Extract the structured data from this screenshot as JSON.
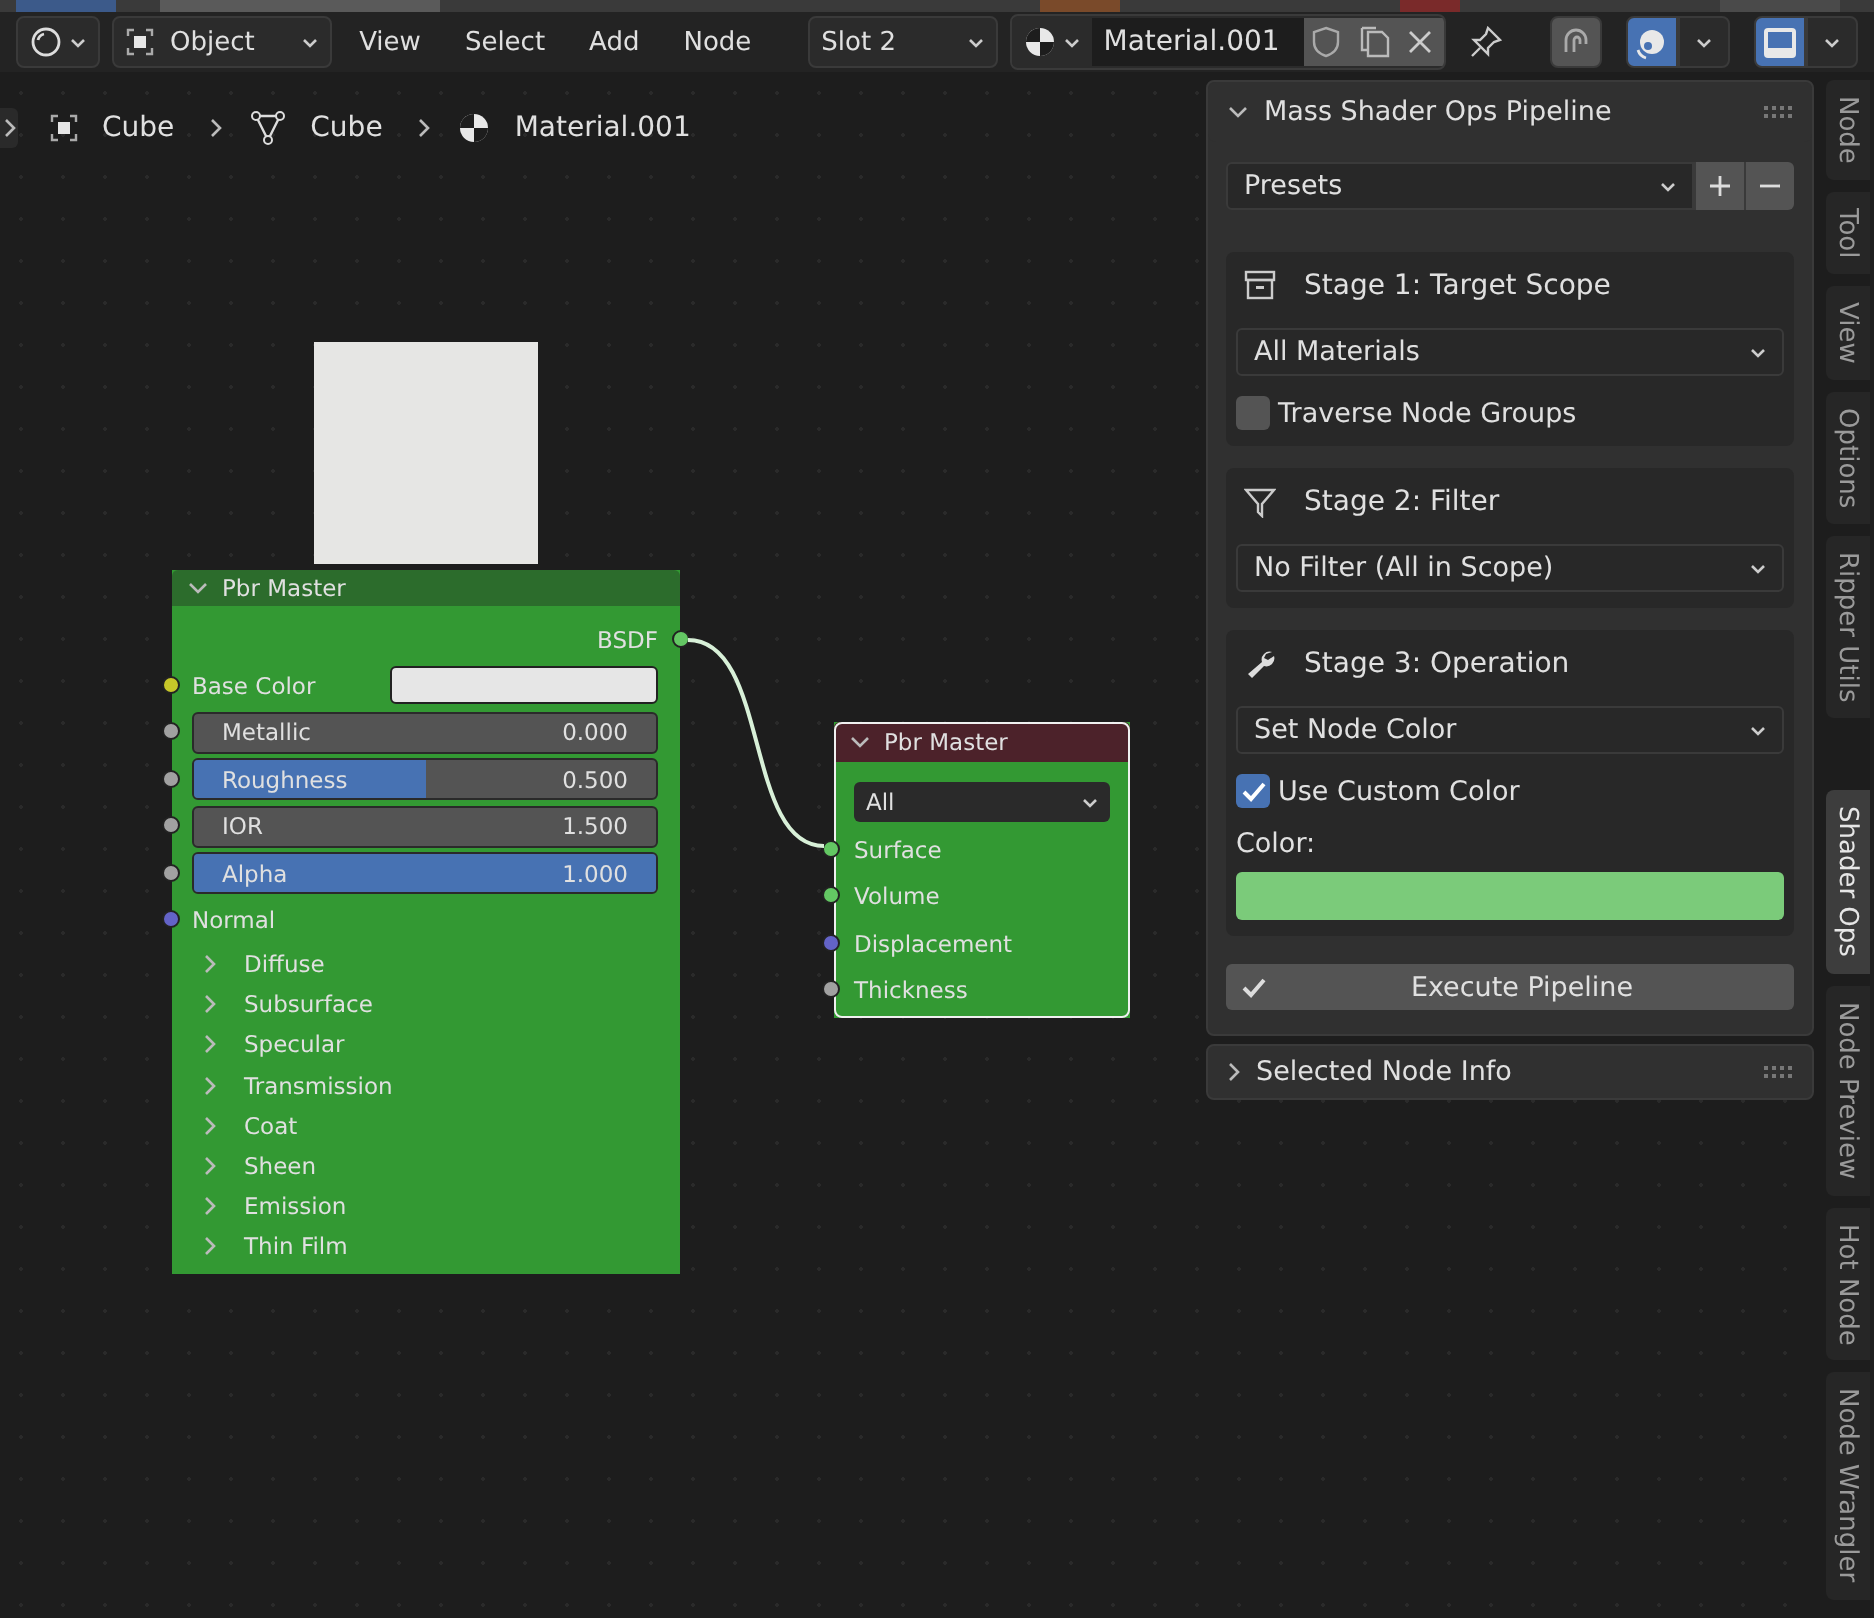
{
  "header": {
    "mode": "Object",
    "menus": [
      "View",
      "Select",
      "Add",
      "Node"
    ],
    "slot": "Slot 2",
    "material": "Material.001",
    "toggles": [
      {
        "kind": "snap",
        "on": false
      },
      {
        "kind": "overlay",
        "on": true
      },
      {
        "kind": "display",
        "on": true
      }
    ]
  },
  "breadcrumbs": [
    {
      "kind": "object",
      "label": "Cube"
    },
    {
      "kind": "mesh",
      "label": "Cube"
    },
    {
      "kind": "material",
      "label": "Material.001"
    }
  ],
  "preview": {
    "color": "#e6e6e4"
  },
  "nodes": [
    {
      "title": "Pbr Master",
      "color": "#2c6c2c",
      "selected": false,
      "outputs": [
        {
          "label": "BSDF",
          "color": "#63c763"
        }
      ],
      "rows": [
        {
          "kind": "color",
          "label": "Base Color",
          "color": "#c7c729"
        },
        {
          "kind": "number",
          "label": "Metallic",
          "value": "0.000",
          "color": "#a1a1a1"
        },
        {
          "kind": "slider",
          "label": "Roughness",
          "value": "0.500",
          "level": 0.5,
          "color": "#a1a1a1"
        },
        {
          "kind": "number",
          "label": "IOR",
          "value": "1.500",
          "color": "#a1a1a1"
        },
        {
          "kind": "slider",
          "label": "Alpha",
          "value": "1.000",
          "level": 1,
          "color": "#a1a1a1"
        },
        {
          "kind": "socket",
          "label": "Normal",
          "color": "#6363c7"
        },
        {
          "kind": "panel",
          "label": "Diffuse",
          "expanded": false
        },
        {
          "kind": "panel",
          "label": "Subsurface",
          "expanded": false
        },
        {
          "kind": "panel",
          "label": "Specular",
          "expanded": false
        },
        {
          "kind": "panel",
          "label": "Transmission",
          "expanded": false
        },
        {
          "kind": "panel",
          "label": "Coat",
          "expanded": false
        },
        {
          "kind": "panel",
          "label": "Sheen",
          "expanded": false
        },
        {
          "kind": "panel",
          "label": "Emission",
          "expanded": false
        },
        {
          "kind": "panel",
          "label": "Thin Film",
          "expanded": false
        }
      ]
    },
    {
      "title": "Pbr Master",
      "color": "#4c222a",
      "selected": true,
      "dropdown": "All",
      "rows": [
        {
          "kind": "socket",
          "label": "Surface",
          "color": "#63c763"
        },
        {
          "kind": "socket",
          "label": "Volume",
          "color": "#63c763"
        },
        {
          "kind": "socket",
          "label": "Displacement",
          "color": "#6363c7"
        },
        {
          "kind": "socket",
          "label": "Thickness",
          "color": "#a1a1a1"
        }
      ]
    }
  ],
  "sidebar": {
    "title": "Mass Shader Ops Pipeline",
    "expanded": true,
    "presets": "Presets",
    "stages": [
      {
        "title": "Stage 1: Target Scope",
        "dropdown": "All Materials",
        "checkbox": {
          "label": "Traverse Node Groups",
          "checked": false
        }
      },
      {
        "title": "Stage 2: Filter",
        "dropdown": "No Filter (All in Scope)"
      },
      {
        "title": "Stage 3: Operation",
        "dropdown": "Set Node Color",
        "checkbox": {
          "label": "Use Custom Color",
          "checked": true
        },
        "color_label": "Color:",
        "color": "#7bcb7a"
      }
    ],
    "execute": "Execute Pipeline",
    "collapsed_panel": {
      "title": "Selected Node Info",
      "expanded": false
    }
  },
  "tabs": [
    {
      "label": "Node",
      "selected": false
    },
    {
      "label": "Tool",
      "selected": false
    },
    {
      "label": "View",
      "selected": false
    },
    {
      "label": "Options",
      "selected": false
    },
    {
      "label": "Ripper Utils",
      "selected": false
    },
    {
      "label": "Shader Ops",
      "selected": true
    },
    {
      "label": "Node Preview",
      "selected": false
    },
    {
      "label": "Hot Node",
      "selected": false
    },
    {
      "label": "Node Wrangler",
      "selected": false
    }
  ]
}
